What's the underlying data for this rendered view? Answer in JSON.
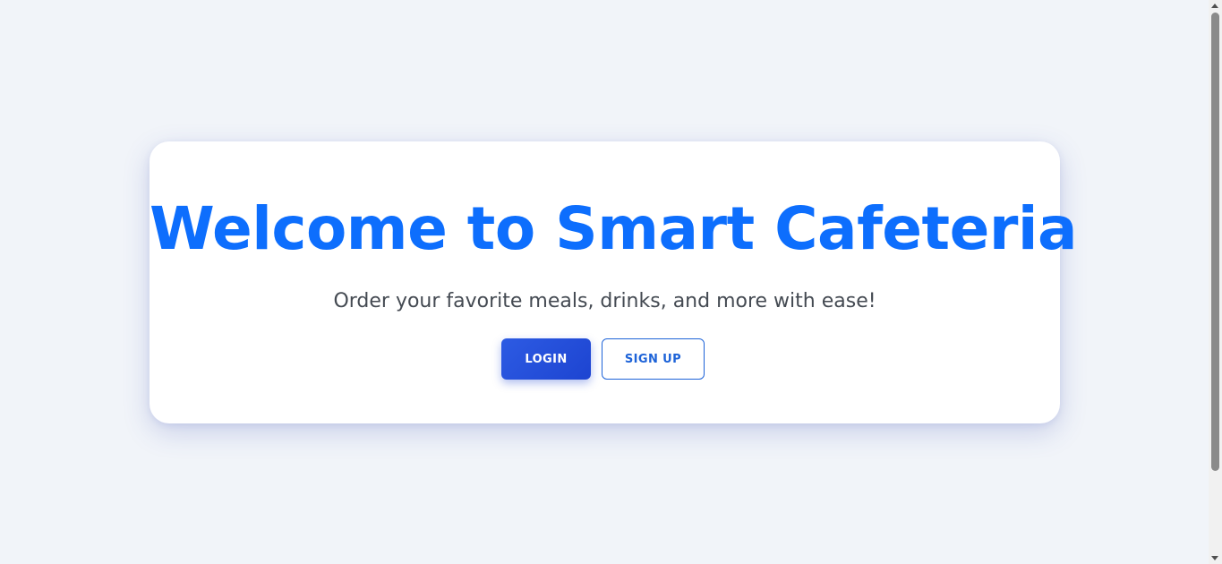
{
  "hero": {
    "title": "Welcome to Smart Cafeteria",
    "subtitle": "Order your favorite meals, drinks, and more with ease!",
    "login_label": "LOGIN",
    "signup_label": "SIGN UP"
  },
  "colors": {
    "background": "#f1f4f9",
    "title": "#0d6efd",
    "primary_button": "#1d44d1",
    "outline_button": "#1d63d8"
  },
  "scrollbar": {
    "up_icon": "chevron-up-icon",
    "down_icon": "chevron-down-icon"
  }
}
